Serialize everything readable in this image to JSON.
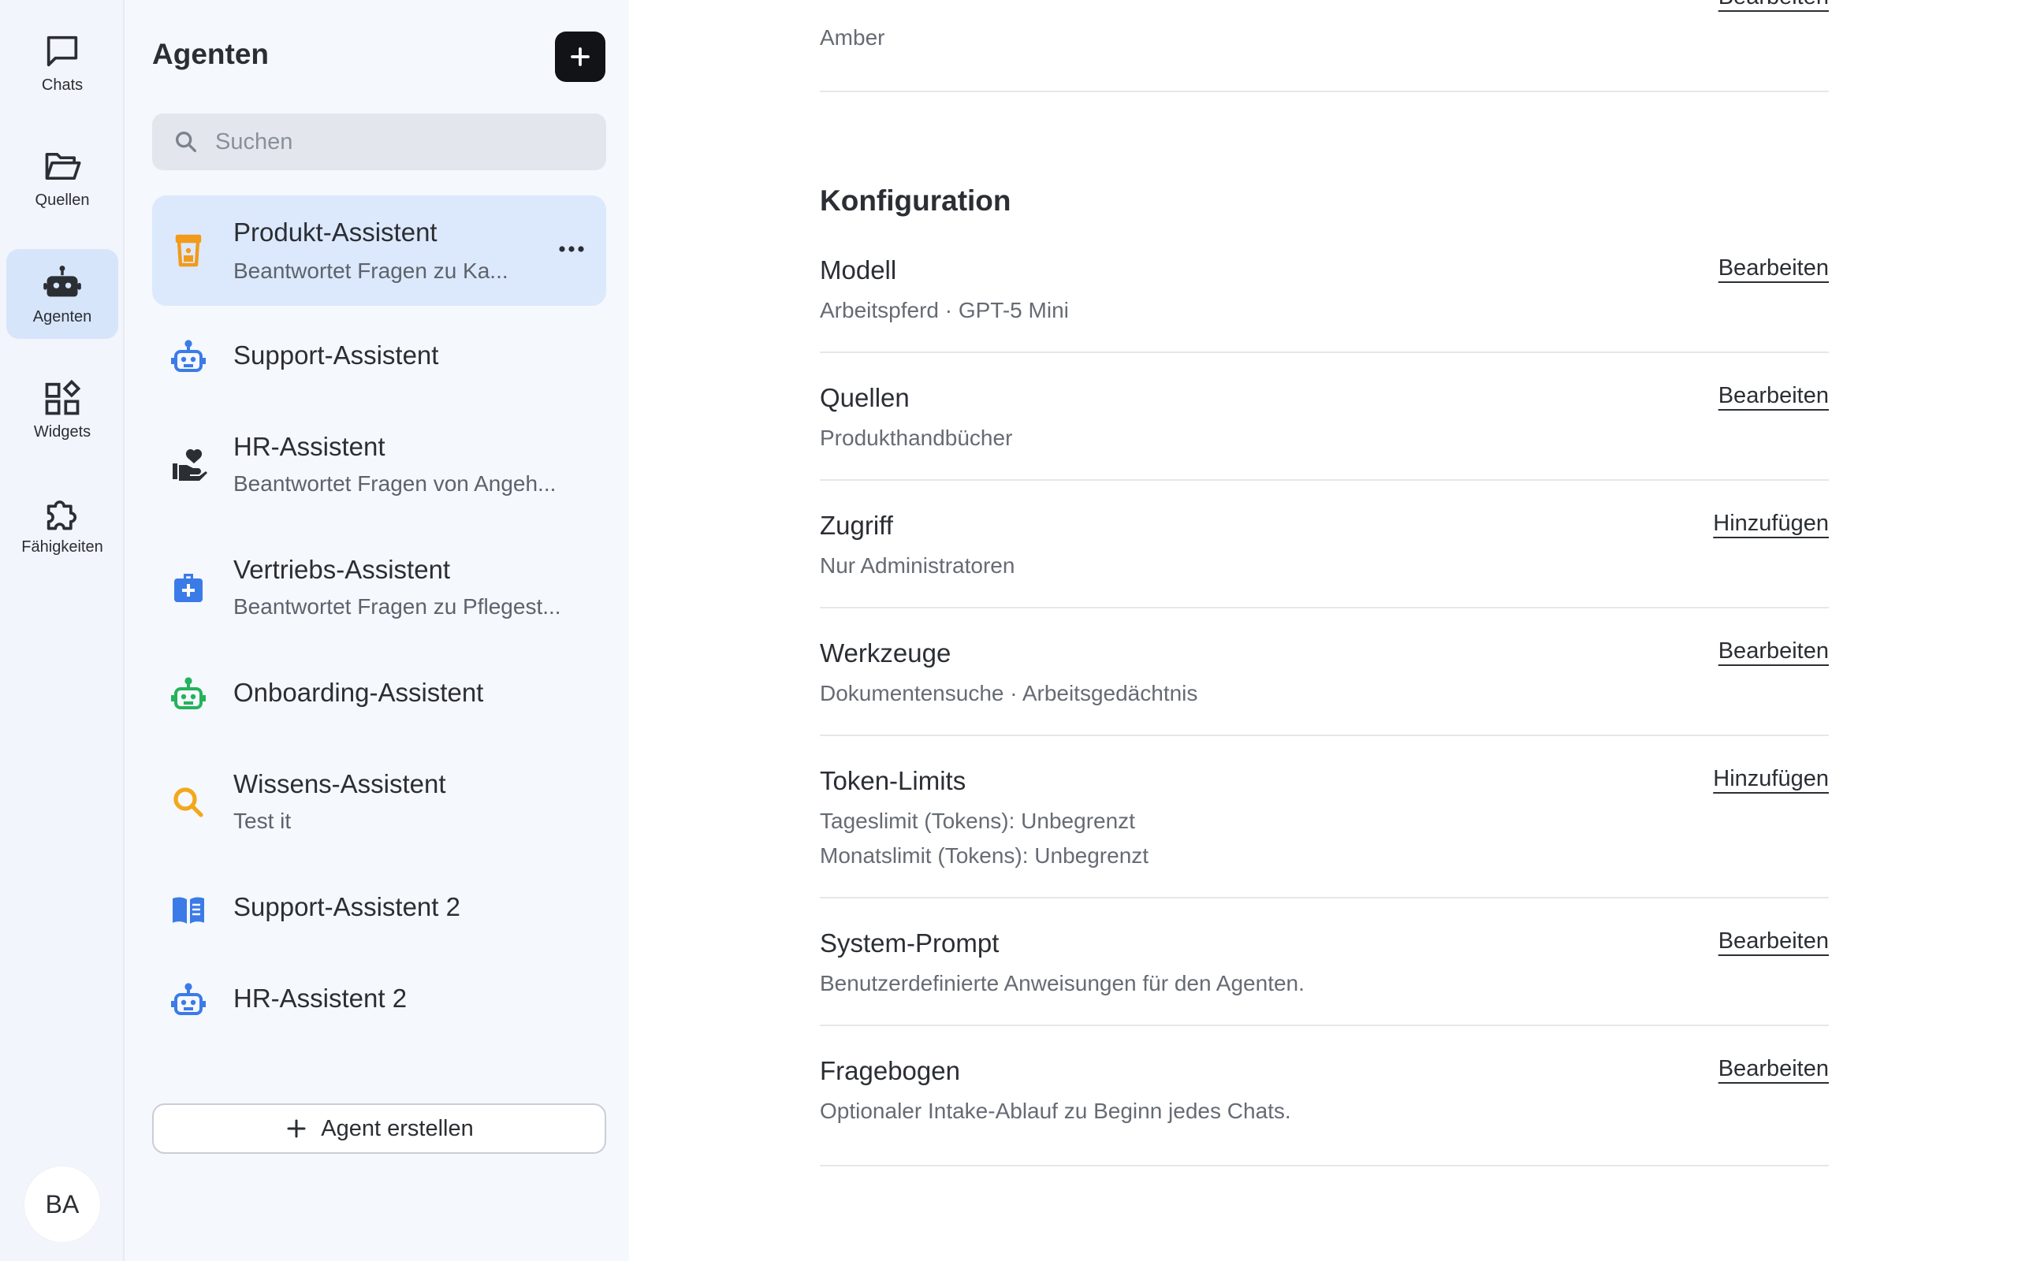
{
  "rail": {
    "items": [
      {
        "label": "Chats",
        "icon": "chat-bubble-icon"
      },
      {
        "label": "Quellen",
        "icon": "folder-open-icon"
      },
      {
        "label": "Agenten",
        "icon": "robot-icon"
      },
      {
        "label": "Widgets",
        "icon": "widgets-icon"
      },
      {
        "label": "Fähigkeiten",
        "icon": "puzzle-icon"
      }
    ],
    "user_initials": "BA"
  },
  "panel": {
    "title": "Agenten",
    "search_placeholder": "Suchen",
    "create_label": "Agent erstellen",
    "agents": [
      {
        "name": "Produkt-Assistent",
        "description": "Beantwortet Fragen zu Ka...",
        "icon": "beverage-icon",
        "icon_color": "#f29a1a",
        "selected": true
      },
      {
        "name": "Support-Assistent",
        "description": "",
        "icon": "robot-icon",
        "icon_color": "#3b7be8"
      },
      {
        "name": "HR-Assistent",
        "description": "Beantwortet Fragen von Angeh...",
        "icon": "hand-heart-icon",
        "icon_color": "#2b2e33"
      },
      {
        "name": "Vertriebs-Assistent",
        "description": "Beantwortet Fragen zu Pflegest...",
        "icon": "medical-bag-icon",
        "icon_color": "#3b7be8"
      },
      {
        "name": "Onboarding-Assistent",
        "description": "",
        "icon": "robot-icon",
        "icon_color": "#24b35a"
      },
      {
        "name": "Wissens-Assistent",
        "description": "Test it",
        "icon": "search-icon",
        "icon_color": "#f2a81a"
      },
      {
        "name": "Support-Assistent 2",
        "description": "",
        "icon": "book-icon",
        "icon_color": "#3b7be8"
      },
      {
        "name": "HR-Assistent 2",
        "description": "",
        "icon": "robot-icon",
        "icon_color": "#3b7be8"
      }
    ]
  },
  "main": {
    "top_row": {
      "value": "Amber",
      "action": "Bearbeiten"
    },
    "section_title": "Konfiguration",
    "rows": [
      {
        "title": "Modell",
        "values": [
          "Arbeitspferd · GPT-5 Mini"
        ],
        "action": "Bearbeiten"
      },
      {
        "title": "Quellen",
        "values": [
          "Produkthandbücher"
        ],
        "action": "Bearbeiten"
      },
      {
        "title": "Zugriff",
        "values": [
          "Nur Administratoren"
        ],
        "action": "Hinzufügen"
      },
      {
        "title": "Werkzeuge",
        "values": [
          "Dokumentensuche · Arbeitsgedächtnis"
        ],
        "action": "Bearbeiten"
      },
      {
        "title": "Token-Limits",
        "values": [
          "Tageslimit (Tokens): Unbegrenzt",
          "Monatslimit (Tokens): Unbegrenzt"
        ],
        "action": "Hinzufügen"
      },
      {
        "title": "System-Prompt",
        "values": [
          "Benutzerdefinierte Anweisungen für den Agenten."
        ],
        "action": "Bearbeiten"
      },
      {
        "title": "Fragebogen",
        "values": [
          "Optionaler Intake-Ablauf zu Beginn jedes Chats."
        ],
        "action": "Bearbeiten"
      }
    ]
  }
}
